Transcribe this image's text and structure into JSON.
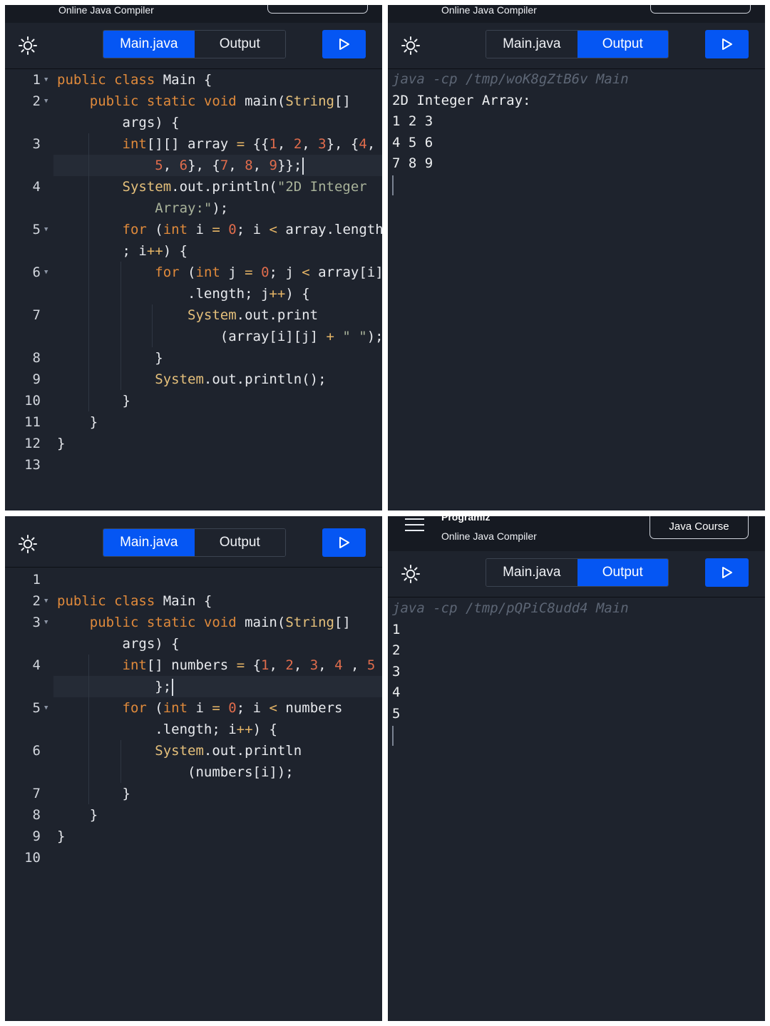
{
  "header": {
    "brand": "Programiz",
    "subtitle": "Online Java Compiler",
    "course_button": "Java Course"
  },
  "tabs": {
    "main_label": "Main.java",
    "output_label": "Output"
  },
  "icons": {
    "theme": "sun-icon",
    "run": "play-icon",
    "menu": "hamburger-icon"
  },
  "colors": {
    "accent": "#0556f3",
    "panel_bg": "#1e232d",
    "keyword": "#e08a3b",
    "number": "#e06c4c"
  },
  "program1": {
    "line_numbers": [
      "1",
      "2",
      "",
      "3",
      "",
      "4",
      "",
      "5",
      "",
      "6",
      "",
      "7",
      "",
      "8",
      "9",
      "10",
      "11",
      "12",
      "13"
    ],
    "code_lines": [
      "public class Main {",
      "    public static void main(String[]",
      "        args) {",
      "        int[][] array = {{1, 2, 3}, {4,",
      "            5, 6}, {7, 8, 9}};",
      "        System.out.println(\"2D Integer",
      "            Array:\");",
      "        for (int i = 0; i < array.length",
      "        ; i++) {",
      "            for (int j = 0; j < array[i]",
      "                .length; j++) {",
      "                System.out.print",
      "                    (array[i][j] + \" \");",
      "            }",
      "            System.out.println();",
      "        }",
      "    }",
      "}",
      ""
    ]
  },
  "output1": {
    "command": "java -cp /tmp/woK8gZtB6v Main",
    "lines": [
      "2D Integer Array:",
      "1 2 3",
      "4 5 6",
      "7 8 9"
    ]
  },
  "program2": {
    "line_numbers": [
      "1",
      "2",
      "3",
      "",
      "4",
      "",
      "5",
      "",
      "6",
      "",
      "7",
      "8",
      "9",
      "10"
    ],
    "code_lines": [
      "",
      "public class Main {",
      "    public static void main(String[]",
      "        args) {",
      "        int[] numbers = {1, 2, 3, 4 , 5",
      "            };",
      "        for (int i = 0; i < numbers",
      "            .length; i++) {",
      "            System.out.println",
      "                (numbers[i]);",
      "        }",
      "    }",
      "}",
      ""
    ]
  },
  "output2": {
    "command": "java -cp /tmp/pQPiC8udd4 Main",
    "lines": [
      "1",
      "2",
      "3",
      "4",
      "5"
    ]
  }
}
